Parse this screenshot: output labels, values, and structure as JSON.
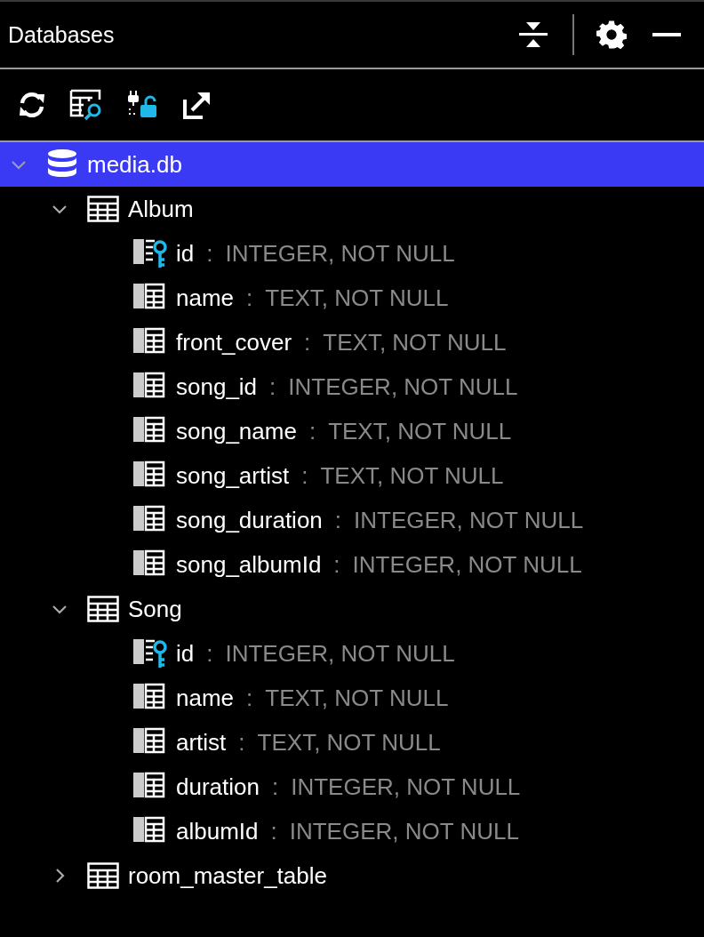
{
  "panel": {
    "title": "Databases"
  },
  "tree": [
    {
      "kind": "database",
      "label": "media.db",
      "expanded": true,
      "selected": true,
      "children": [
        {
          "kind": "table",
          "label": "Album",
          "expanded": true,
          "selected": false,
          "children": [
            {
              "kind": "primary-key",
              "label": "id",
              "separator": ":",
              "type": "INTEGER, NOT NULL",
              "selected": false
            },
            {
              "kind": "column",
              "label": "name",
              "separator": ":",
              "type": "TEXT, NOT NULL",
              "selected": false
            },
            {
              "kind": "column",
              "label": "front_cover",
              "separator": ":",
              "type": "TEXT, NOT NULL",
              "selected": false
            },
            {
              "kind": "column",
              "label": "song_id",
              "separator": ":",
              "type": "INTEGER, NOT NULL",
              "selected": false
            },
            {
              "kind": "column",
              "label": "song_name",
              "separator": ":",
              "type": "TEXT, NOT NULL",
              "selected": false
            },
            {
              "kind": "column",
              "label": "song_artist",
              "separator": ":",
              "type": "TEXT, NOT NULL",
              "selected": false
            },
            {
              "kind": "column",
              "label": "song_duration",
              "separator": ":",
              "type": "INTEGER, NOT NULL",
              "selected": false
            },
            {
              "kind": "column",
              "label": "song_albumId",
              "separator": ":",
              "type": "INTEGER, NOT NULL",
              "selected": false
            }
          ]
        },
        {
          "kind": "table",
          "label": "Song",
          "expanded": true,
          "selected": false,
          "children": [
            {
              "kind": "primary-key",
              "label": "id",
              "separator": ":",
              "type": "INTEGER, NOT NULL",
              "selected": false
            },
            {
              "kind": "column",
              "label": "name",
              "separator": ":",
              "type": "TEXT, NOT NULL",
              "selected": false
            },
            {
              "kind": "column",
              "label": "artist",
              "separator": ":",
              "type": "TEXT, NOT NULL",
              "selected": false
            },
            {
              "kind": "column",
              "label": "duration",
              "separator": ":",
              "type": "INTEGER, NOT NULL",
              "selected": false
            },
            {
              "kind": "column",
              "label": "albumId",
              "separator": ":",
              "type": "INTEGER, NOT NULL",
              "selected": false
            }
          ]
        },
        {
          "kind": "table",
          "label": "room_master_table",
          "expanded": false,
          "selected": false
        }
      ]
    }
  ]
}
